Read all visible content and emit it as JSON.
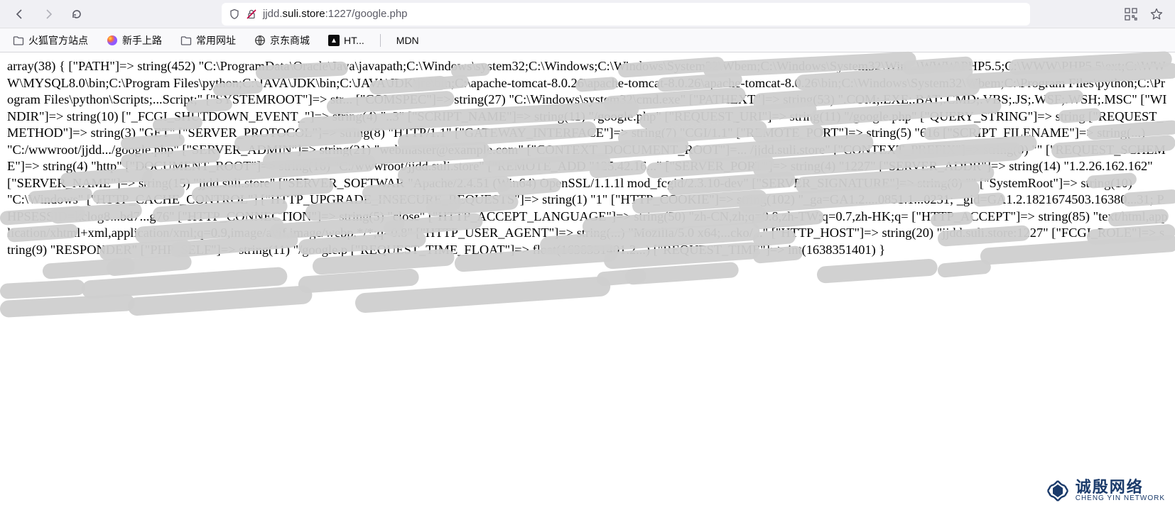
{
  "url": {
    "prefix": "jjdd.",
    "domain": "suli.store",
    "suffix": ":1227/google.php"
  },
  "bookmarks": [
    {
      "label": "火狐官方站点",
      "icon": "folder"
    },
    {
      "label": "新手上路",
      "icon": "firefox"
    },
    {
      "label": "常用网址",
      "icon": "folder"
    },
    {
      "label": "京东商城",
      "icon": "jd"
    },
    {
      "label": "HT...",
      "icon": "dark"
    }
  ],
  "bookmark_after_sep": {
    "label": "MDN"
  },
  "body_text": "array(38) { [\"PATH\"]=> string(452) \"C:\\ProgramData\\Oracle\\Java\\javapath;C:\\Windows\\system32;C:\\Windows;C:\\Windows\\System32\\Wbem;C:\\Windows\\System32\\Win...\\WWW\\PHP5.5;C:\\WWW\\PHP5.5\\ext;C:\\WWW\\MYSQL8.0\\bin;C:\\Program Files\\python;C:\\JAVA\\JDK\\bin;C:\\JAVA\\JDK\\jre\\bin;C:\\apache-tomcat-8.0.26\\apache-tomcat-8.0.26\\apache-tomcat-8.0.26\\bin;C:\\Windows\\System32\\Wbem;C:\\Program Files\\python;C:\\Program Files\\python\\Scripts;...Script;\" [\"SYSTEMROOT\"]=> str... [\"COMSPEC\"]=> string(27) \"C:\\Windows\\system32\\cmd.exe\" [\"PATHEXT\"]=> string(53) \".COM;.EXE;.BAT;.CMD;.VBS;.JS;.WSF;.WSH;.MSC\" [\"WINDIR\"]=> string(10) [\"_FCGI_SHUTDOWN_EVENT_\"]=> string(4) \"..3\" [\"SCRIPT_NAME\"]=> string(11) \"/google.php\" [\"REQUEST_URI\"]=> string(11) \"/google.php\" [\"QUERY_STRING\"]=> string [\"REQUEST_METHOD\"]=> string(3) \"GET\" [\"SERVER_PROTOCOL\"]=> string(8) \"HTTP/1.1\" [\"GATEWAY_INTERFACE\"]=> string(7) \"CGI/1.1\" [\"REMOTE_PORT\"]=> string(5) \"616 [\"SCRIPT_FILENAME\"]=> string(...) \"C:/wwwroot/jjdd.../google.php\" [\"SERVER_ADMIN\"]=> string(21) \"webmaster@example.com\" [\"CONTEXT_DOCUMENT_ROOT\"]=... /jjdd.suli.store\" [\"CONTEXT_PREFIX\"]=> string(0) \"\" [\"REQUEST_SCHEME\"]=> string(4) \"http\" [\"DOCUMENT_ROOT\"]=> string(16) \"C:/wwwroot/jjdd.suli.store\" [\"REMOTE_ADD \"125.42.16...\" [\"SERVER_PORT\"]=> string(4) \"1227\" [\"SERVER_ADDR\"]=> string(14) \"1.2.26.162.162\" [\"SERVER_NAME\"]=> string(15) \"jjdd.suli.store\" [\"SERVER_SOFTWAR \"Apache/2.4.51 (Win64) OpenSSL/1.1.1l mod_fcgid/2.3.10-dev\" [\"SERVER_SIGNATURE\"]=> string(0) \"\" [\"SystemRoot\"]=> string(10) \"C:\\Windows\" [\"HTTP_CACHE_CONTROL\"] [\"HTTP_UPGRADE_INSECURE_REQUESTS\"]=> string(1) \"1\" [\"HTTP_COOKIE\"]=> string(102) \"_ga=GA1.2....0851.1...0231; _gid=GA1.2.1821674503.16380...31; PHPSESSID=kclog8...bd7...g76\" [\"HTTP_CONNECTION\"]=> string(5) \"close\" [\"HTTP_ACCEPT_LANGUAGE\"]=> string(50) \"zh-CN,zh;q=0.8,zh-TW;q=0.7,zh-HK;q= [\"HTTP_ACCEPT\"]=> string(85) \"text/html,application/xhtml+xml,application/xml;q=0.9,image/avif,image/webp,*/*;q=0.8\" [\"HTTP_USER_AGENT\"]=> string(...) \"Mozilla/5.0 x64;...cko/...\" [\"HTTP_HOST\"]=> string(20) \"jjdd.suli.store:1227\" [\"FCGI_ROLE\"]=> string(9) \"RESPONDER\" [\"PHP_SELF\"]=> string(11) \"/google.p [\"REQUEST_TIME_FLOAT\"]=> float(1638351401.2...) [\"REQUEST_TIME\"]=> int(1638351401) }",
  "watermark": {
    "cn": "诚殷网络",
    "en": "CHENG YIN NETWORK"
  }
}
